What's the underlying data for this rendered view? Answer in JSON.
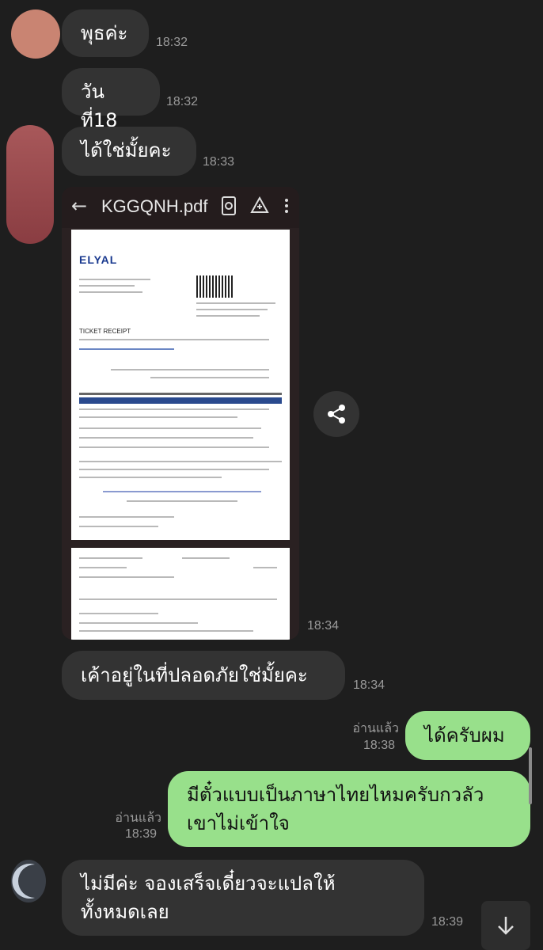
{
  "messages": {
    "m1": {
      "text": "พุธค่ะ",
      "time": "18:32"
    },
    "m2": {
      "text": "วันที่18",
      "time": "18:32"
    },
    "m3": {
      "text": "ได้ใช่มั้ยคะ",
      "time": "18:33"
    },
    "image": {
      "filename": "KGGQNH.pdf",
      "time": "18:34",
      "logo": "ELYAL",
      "receipt_title": "TICKET RECEIPT"
    },
    "m4": {
      "text": "เค้าอยู่ในที่ปลอดภัยใช่มั้ยคะ",
      "time": "18:34"
    },
    "m5": {
      "text": "ได้ครับผม",
      "read": "อ่านแล้ว",
      "time": "18:38"
    },
    "m6": {
      "line1": "มีตั๋วแบบเป็นภาษาไทยไหมครับกวลัว",
      "line2": "เขาไม่เข้าใจ",
      "read": "อ่านแล้ว",
      "time": "18:39"
    },
    "m7": {
      "line1": "ไม่มีค่ะ จองเสร็จเดี๋ยวจะแปลให้",
      "line2": "ทั้งหมดเลย",
      "time": "18:39"
    }
  },
  "icons": {
    "share": "share-icon",
    "scroll": "arrow-down-icon"
  },
  "colors": {
    "background": "#1e1e1e",
    "incoming": "#333333",
    "outgoing": "#98e08b"
  }
}
